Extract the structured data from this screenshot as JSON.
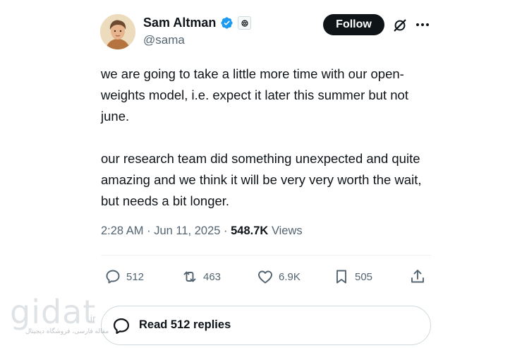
{
  "author": {
    "name": "Sam Altman",
    "handle": "@sama",
    "verified_color": "#1d9bf0"
  },
  "header": {
    "follow_label": "Follow",
    "grok_icon": "grok-icon",
    "more_icon": "more-icon"
  },
  "tweet": {
    "paragraphs": [
      "we are going to take a little more time with our open-weights model, i.e. expect it later this summer but not june.",
      "our research team did something unexpected and quite amazing and we think it will be very very worth the wait, but needs a bit longer."
    ],
    "time": "2:28 AM",
    "separator": "·",
    "date": "Jun 11, 2025",
    "views_count": "548.7K",
    "views_label": "Views"
  },
  "actions": {
    "replies": "512",
    "reposts": "463",
    "likes": "6.9K",
    "bookmarks": "505"
  },
  "read_replies": {
    "label": "Read 512 replies"
  },
  "watermark": {
    "word": "gidat",
    "dot": ".ir",
    "subtitle": "مقاله فارسی، فروشگاه دیجیتال"
  },
  "colors": {
    "text_primary": "#0f1419",
    "text_secondary": "#536471",
    "follow_bg": "#0f1419",
    "border": "#cfd9de"
  }
}
